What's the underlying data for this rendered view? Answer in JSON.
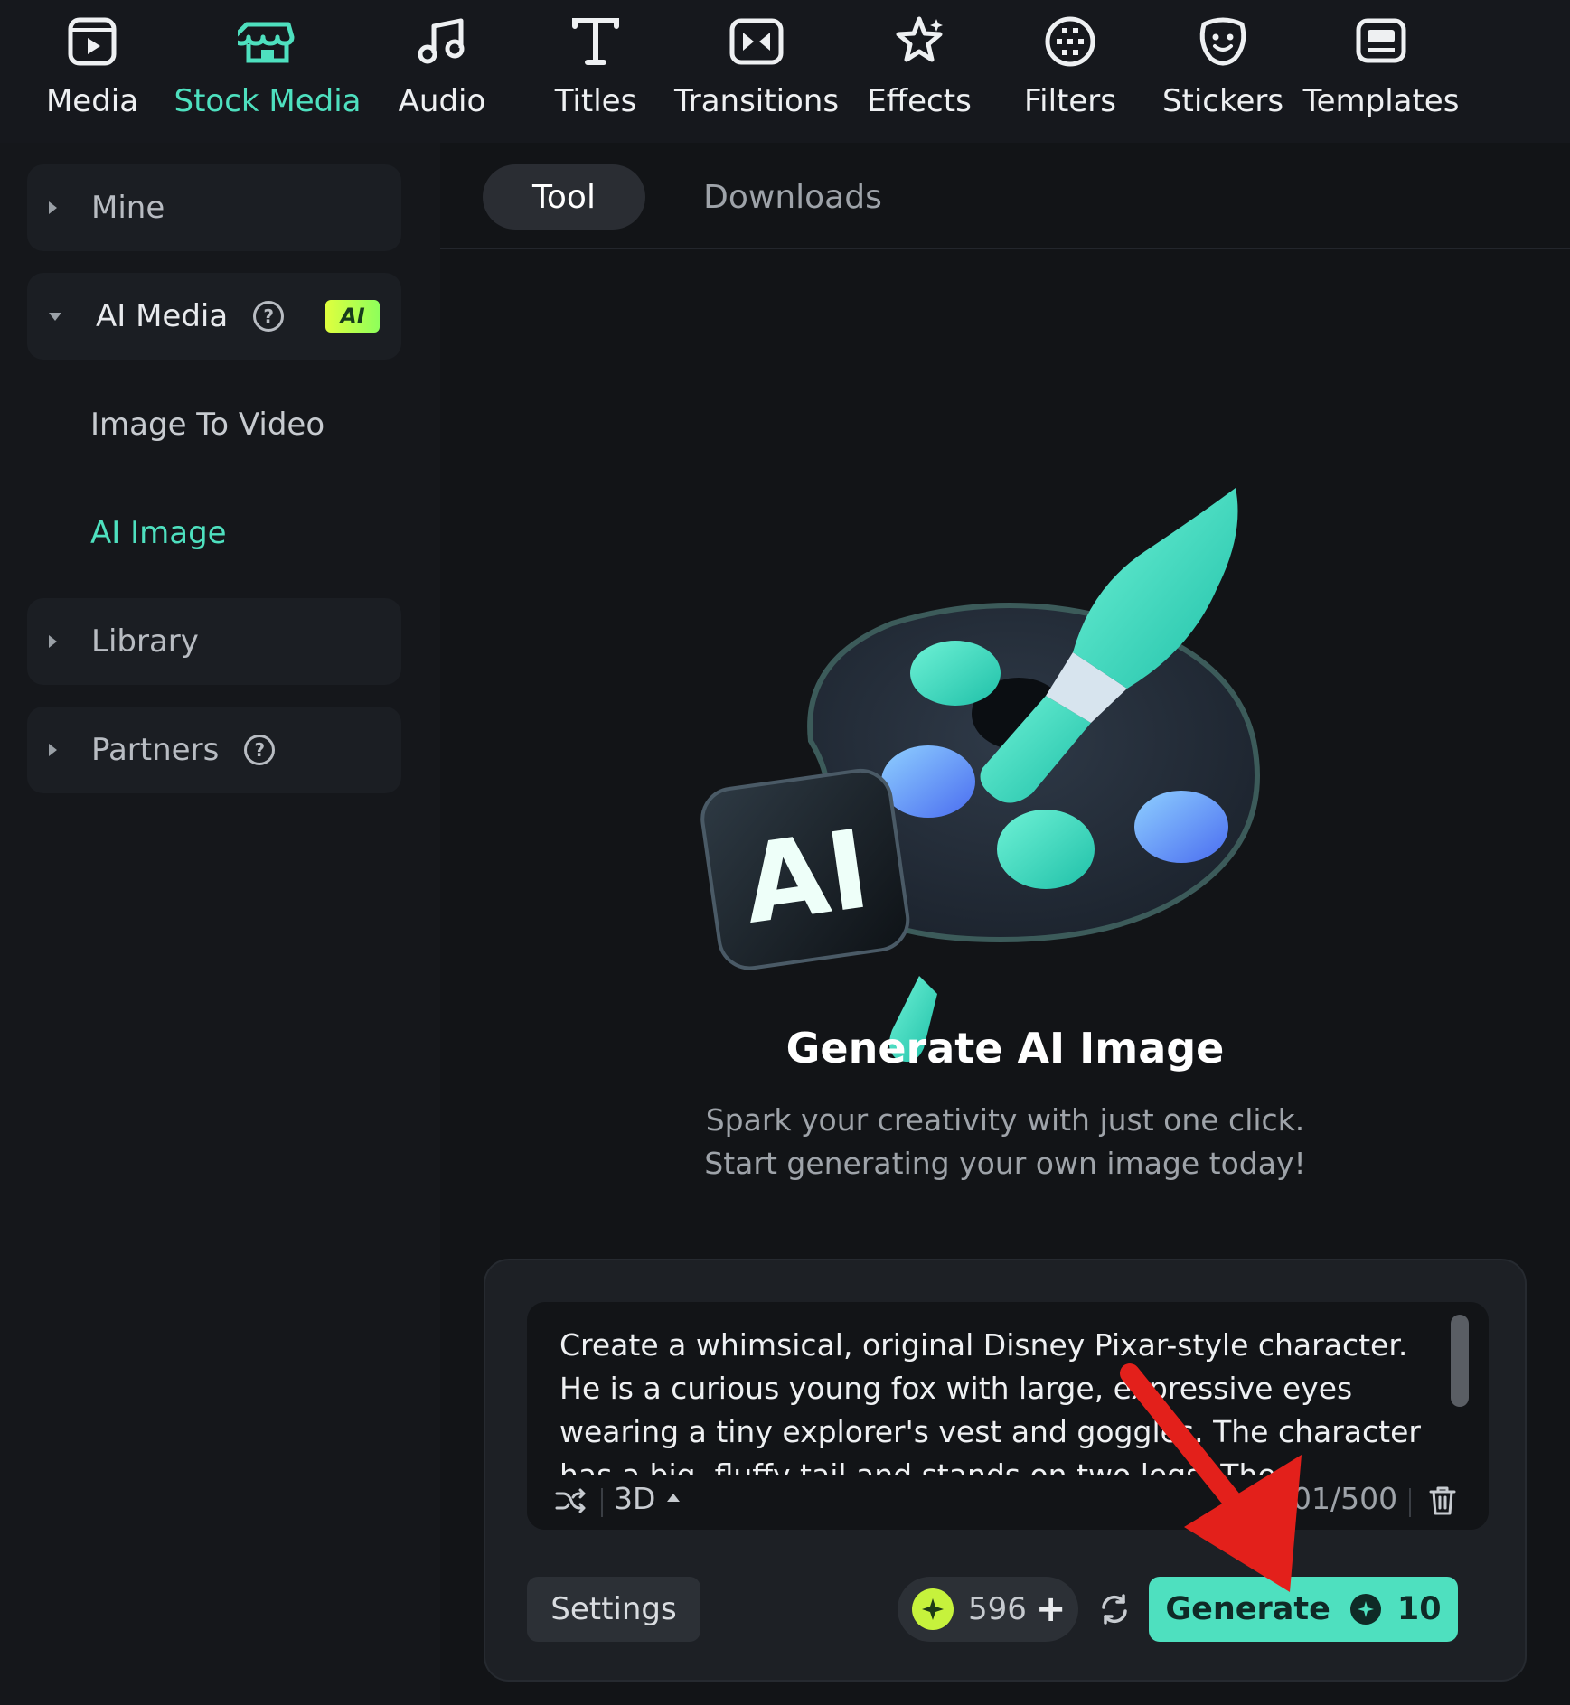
{
  "toolbar": {
    "items": [
      {
        "label": "Media",
        "icon": "media-icon"
      },
      {
        "label": "Stock Media",
        "icon": "stock-media-icon",
        "active": true
      },
      {
        "label": "Audio",
        "icon": "music-note-icon"
      },
      {
        "label": "Titles",
        "icon": "text-t-icon"
      },
      {
        "label": "Transitions",
        "icon": "transitions-icon"
      },
      {
        "label": "Effects",
        "icon": "effects-star-icon"
      },
      {
        "label": "Filters",
        "icon": "filters-icon"
      },
      {
        "label": "Stickers",
        "icon": "sticker-icon"
      },
      {
        "label": "Templates",
        "icon": "templates-icon"
      }
    ]
  },
  "sidebar": {
    "mine": "Mine",
    "ai_media": {
      "label": "AI Media",
      "badge": "AI"
    },
    "sub_items": [
      "Image To Video",
      "AI Image"
    ],
    "library": "Library",
    "partners": "Partners"
  },
  "main": {
    "tabs": [
      "Tool",
      "Downloads"
    ],
    "hero": {
      "illustration_text": "AI",
      "title": "Generate AI Image",
      "subtitle_line1": "Spark your creativity with just one click.",
      "subtitle_line2": "Start generating your own image today!"
    },
    "prompt": {
      "text": "Create a whimsical, original Disney Pixar-style character. He is a curious young fox with large, expressive eyes wearing a tiny explorer's vest and goggles. The character has a big, fluffy tail and stands on two legs. The background is a",
      "style": "3D",
      "count": "301/500"
    },
    "settings_label": "Settings",
    "credits": "596",
    "generate_label": "Generate",
    "generate_cost": "10"
  },
  "colors": {
    "accent": "#4ee0bf",
    "background": "#121417",
    "panel": "#1d2025",
    "annotation_arrow": "#e3201b"
  }
}
